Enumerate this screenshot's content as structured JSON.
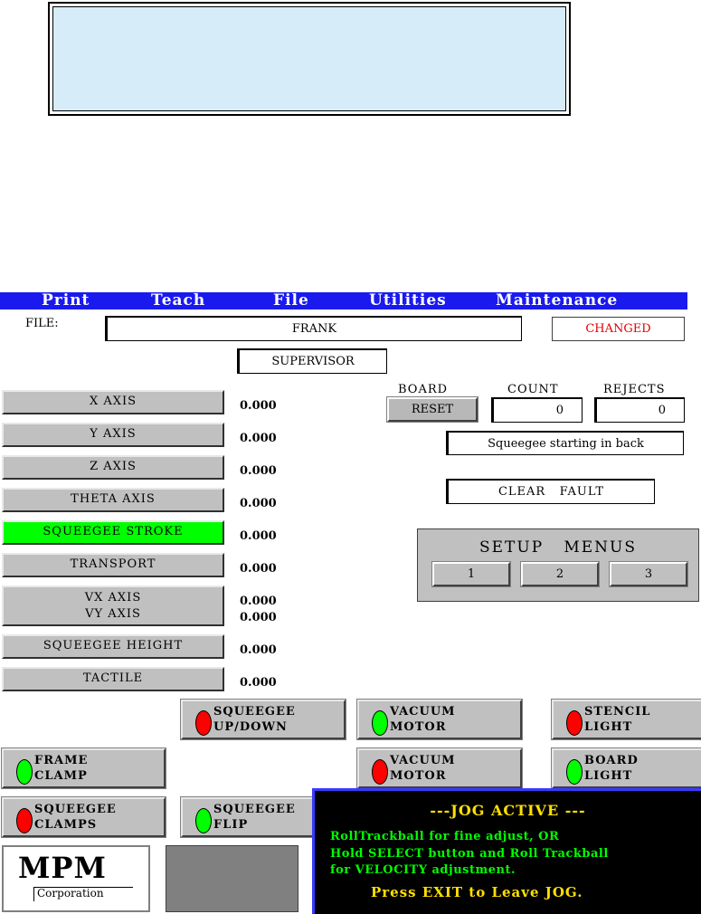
{
  "menu": [
    "Print",
    "Teach",
    "File",
    "Utilities",
    "Maintenance"
  ],
  "file": {
    "label": "FILE:",
    "name": "FRANK",
    "status": "CHANGED",
    "status_color": "#e00000"
  },
  "user": "SUPERVISOR",
  "axes": [
    {
      "label": "X AXIS",
      "value": "0.000"
    },
    {
      "label": "Y AXIS",
      "value": "0.000"
    },
    {
      "label": "Z AXIS",
      "value": "0.000"
    },
    {
      "label": "THETA AXIS",
      "value": "0.000"
    },
    {
      "label": "SQUEEGEE STROKE",
      "value": "0.000",
      "highlight": "#00ff00"
    },
    {
      "label": "TRANSPORT",
      "value": "0.000"
    },
    {
      "label_vx": "VX AXIS",
      "label_vy": "VY AXIS",
      "value_vx": "0.000",
      "value_vy": "0.000"
    },
    {
      "label": "SQUEEGEE HEIGHT",
      "value": "0.000"
    },
    {
      "label": "TACTILE",
      "value": "0.000"
    }
  ],
  "counters": {
    "board_label": "BOARD",
    "reset_label": "RESET",
    "count_label": "COUNT",
    "count_value": "0",
    "rejects_label": "REJECTS",
    "rejects_value": "0"
  },
  "status_message": "Squeegee starting in back",
  "clear_fault": "CLEAR   FAULT",
  "setup": {
    "title": "SETUP   MENUS",
    "buttons": [
      "1",
      "2",
      "3"
    ]
  },
  "toggles": {
    "squeegee_updown": {
      "line1": "SQUEEGEE",
      "line2": "UP/DOWN",
      "led": "red"
    },
    "vacuum_motor_1": {
      "line1": "VACUUM",
      "line2": "MOTOR",
      "led": "green"
    },
    "stencil_light": {
      "line1": "STENCIL",
      "line2": "LIGHT",
      "led": "red"
    },
    "frame_clamp": {
      "line1": "FRAME",
      "line2": "CLAMP",
      "led": "green"
    },
    "vacuum_motor_2": {
      "line1": "VACUUM",
      "line2": "MOTOR",
      "led": "red"
    },
    "board_light": {
      "line1": "BOARD",
      "line2": "LIGHT",
      "led": "green"
    },
    "squeegee_clamps": {
      "line1": "SQUEEGEE",
      "line2": "CLAMPS",
      "led": "red"
    },
    "squeegee_flip": {
      "line1": "SQUEEGEE",
      "line2": "FLIP",
      "led": "green"
    }
  },
  "colors": {
    "red": "#ff0000",
    "green": "#00ff00"
  },
  "logo": {
    "main": "MPM",
    "sub": "Corporation"
  },
  "jog": {
    "title": "---JOG ACTIVE ---",
    "line1": "RollTrackball for fine adjust, OR",
    "line2": "Hold SELECT button and Roll Trackball",
    "line3": "for VELOCITY adjustment.",
    "exit": "Press EXIT to Leave JOG."
  }
}
